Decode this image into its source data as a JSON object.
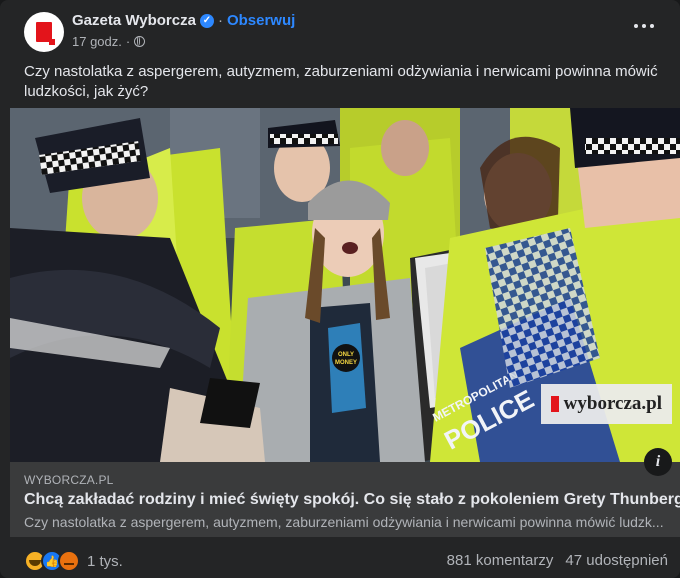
{
  "header": {
    "page_name": "Gazeta Wyborcza",
    "verified_icon": "verified-badge-icon",
    "separator": "·",
    "follow_label": "Obserwuj",
    "time": "17 godz.",
    "meta_separator": "·",
    "audience_icon": "globe-icon",
    "more_icon": "more-horizontal-icon"
  },
  "post": {
    "text": "Czy nastolatka z aspergerem, autyzmem, zaburzeniami odżywiania i nerwicami powinna mówić ludzkości, jak żyć?"
  },
  "image": {
    "watermark": "wyborcza.pl",
    "police_jacket_text": "METROPOLITAN POLICE",
    "shirt_text": "ONLY MONEY FEST"
  },
  "link_card": {
    "domain": "WYBORCZA.PL",
    "headline": "Chcą zakładać rodziny i mieć święty spokój. Co się stało z pokoleniem Grety Thunberg",
    "description": "Czy nastolatka z aspergerem, autyzmem, zaburzeniami odżywiania i nerwicami powinna mówić ludzk...",
    "info_label": "i"
  },
  "footer": {
    "reaction_icons": [
      "haha-reaction-icon",
      "like-reaction-icon",
      "angry-reaction-icon"
    ],
    "reaction_count": "1 tys.",
    "comments": "881 komentarzy",
    "shares": "47 udostępnień"
  },
  "colors": {
    "background": "#242526",
    "accent": "#2d88ff",
    "card": "#3a3b3c",
    "brand_red": "#e3141b",
    "hi_vis": "#c8e630"
  }
}
